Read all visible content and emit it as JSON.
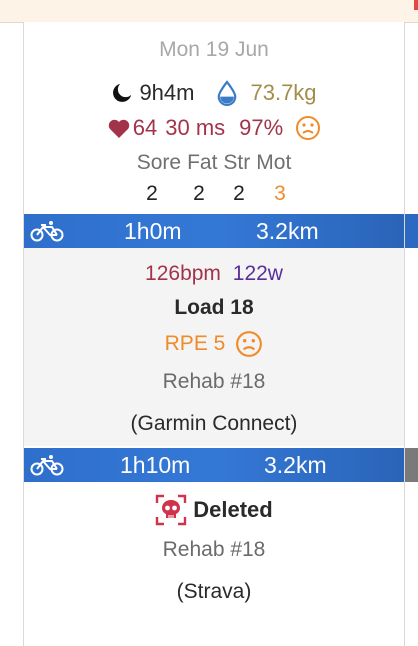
{
  "day": {
    "date": "Mon 19 Jun",
    "sleep": "9h4m",
    "weight": "73.7kg",
    "resting_hr": "64",
    "hrv": "30 ms",
    "readiness": "97%",
    "wellness_labels": [
      "Sore",
      "Fat",
      "Str",
      "Mot"
    ],
    "wellness_values": [
      "2",
      "2",
      "2",
      "3"
    ]
  },
  "activities": [
    {
      "duration": "1h0m",
      "distance": "3.2km",
      "avg_hr": "126bpm",
      "avg_power": "122w",
      "load": "Load 18",
      "rpe": "RPE 5",
      "name": "Rehab #18",
      "source": "(Garmin Connect)"
    },
    {
      "duration": "1h10m",
      "distance": "3.2km",
      "status": "Deleted",
      "name": "Rehab #18",
      "source": "(Strava)"
    }
  ],
  "icons": {
    "sleep": "moon-icon",
    "weight": "water-drop-icon",
    "heart": "heart-icon",
    "mood": "sad-face-icon",
    "activity_type": "bicycle-icon",
    "deleted": "skull-icon"
  },
  "colors": {
    "activity_bar": "#3478d6",
    "heart_red": "#a3334a",
    "power_purple": "#5a2f9a",
    "orange": "#ee8c2a",
    "weight_olive": "#a28d4a",
    "deleted_red": "#d0334c"
  }
}
